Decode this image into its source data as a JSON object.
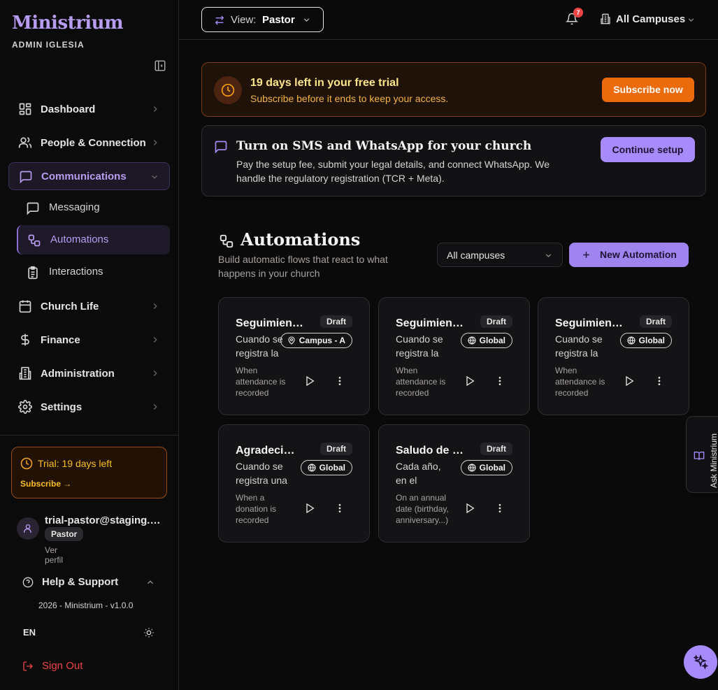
{
  "brand": {
    "name": "Ministrium",
    "subtitle": "ADMIN IGLESIA"
  },
  "sidebar": {
    "items": [
      {
        "label": "Dashboard",
        "icon": "grid-icon"
      },
      {
        "label": "People & Connection",
        "icon": "users-icon"
      },
      {
        "label": "Communications",
        "icon": "message-square-icon"
      },
      {
        "label": "Church Life",
        "icon": "calendar-icon"
      },
      {
        "label": "Finance",
        "icon": "dollar-icon"
      },
      {
        "label": "Administration",
        "icon": "building-icon"
      },
      {
        "label": "Settings",
        "icon": "gear-icon"
      }
    ],
    "sub_items": [
      {
        "label": "Messaging",
        "icon": "message-square-icon"
      },
      {
        "label": "Automations",
        "icon": "workflow-icon"
      },
      {
        "label": "Interactions",
        "icon": "clipboard-icon"
      }
    ],
    "trial": {
      "title": "Trial: 19 days left",
      "cta": "Subscribe →"
    },
    "user": {
      "email": "trial-pastor@staging.ministrium.app",
      "role": "Pastor",
      "profile_link": "Ver perfil"
    },
    "help": "Help & Support",
    "version": "2026 - Ministrium - v1.0.0",
    "language": "EN",
    "sign_out": "Sign Out"
  },
  "topbar": {
    "view_label": "View:",
    "view_value": "Pastor",
    "notification_count": "7",
    "campus_selector": "All Campuses"
  },
  "trial_banner": {
    "title": "19 days left in your free trial",
    "subtitle": "Subscribe before it ends to keep your access.",
    "button": "Subscribe now"
  },
  "sms_banner": {
    "title": "Turn on SMS and WhatsApp for your church",
    "body": "Pay the setup fee, submit your legal details, and connect WhatsApp. We handle the regulatory registration (TCR + Meta).",
    "button": "Continue setup"
  },
  "page": {
    "title": "Automations",
    "subtitle": "Build automatic flows that react to what happens in your church",
    "campus_filter": "All campuses",
    "new_button": "New Automation"
  },
  "cards": [
    {
      "name": "Seguimiento de asistencia",
      "status": "Draft",
      "description": "Cuando se registra la asistencia",
      "scope": "Campus - A",
      "scope_icon": "map-pin-icon",
      "trigger": "When attendance is recorded"
    },
    {
      "name": "Seguimiento de asistencia",
      "status": "Draft",
      "description": "Cuando se registra la asistencia",
      "scope": "Global",
      "scope_icon": "globe-icon",
      "trigger": "When attendance is recorded"
    },
    {
      "name": "Seguimiento de asistencia",
      "status": "Draft",
      "description": "Cuando se registra la asistencia",
      "scope": "Global",
      "scope_icon": "globe-icon",
      "trigger": "When attendance is recorded"
    },
    {
      "name": "Agradecimiento por donación",
      "status": "Draft",
      "description": "Cuando se registra una donación",
      "scope": "Global",
      "scope_icon": "globe-icon",
      "trigger": "When a donation is recorded"
    },
    {
      "name": "Saludo de cumpleaños",
      "status": "Draft",
      "description": "Cada año, en el cumpleaños",
      "scope": "Global",
      "scope_icon": "globe-icon",
      "trigger": "On an annual date (birthday, anniversary...)"
    }
  ],
  "ask_panel": "Ask Ministrium",
  "colors": {
    "accent": "#a78bfa",
    "trial_orange": "#ea6a0c",
    "danger": "#ef4444",
    "background": "#0a0a0b"
  }
}
